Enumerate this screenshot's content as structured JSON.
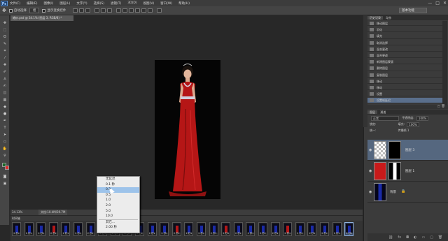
{
  "app": {
    "logo": "Ps"
  },
  "menubar": {
    "items": [
      "文件(F)",
      "编辑(E)",
      "图像(I)",
      "图层(L)",
      "文字(Y)",
      "选择(S)",
      "滤镜(T)",
      "3D(D)",
      "视图(V)",
      "窗口(W)",
      "帮助(H)"
    ],
    "window_controls": [
      "—",
      "□",
      "✕"
    ]
  },
  "options_bar": {
    "auto_select_label": "自动选择",
    "auto_select_value": "组",
    "show_transform_label": "显示变换控件",
    "workspace": "基本功能"
  },
  "document": {
    "tab_title": "婚纱.psd @ 34.1% (图层 3, RGB/8) *",
    "zoom": "34.13%",
    "doc_info": "文档:10.4M/39.7M"
  },
  "timeline": {
    "title": "时间轴",
    "frames": [
      {
        "label": "2 秒▾",
        "color": "blue"
      },
      {
        "label": "2 秒▾",
        "color": "blue"
      },
      {
        "label": "2 秒▾",
        "color": "blue"
      },
      {
        "label": "2 秒▾",
        "color": "red"
      },
      {
        "label": "2 秒▾",
        "color": "blue"
      },
      {
        "label": "2 秒▾",
        "color": "blue"
      },
      {
        "label": "2 秒▾",
        "color": "blue"
      },
      {
        "label": "2 秒▾",
        "color": "blue"
      },
      {
        "label": "2 秒▾",
        "color": "blue"
      },
      {
        "label": "2 秒▾",
        "color": "red"
      },
      {
        "label": "2 秒▾",
        "color": "blue"
      },
      {
        "label": "2 秒▾",
        "color": "blue"
      },
      {
        "label": "2 秒▾",
        "color": "blue"
      },
      {
        "label": "2 秒▾",
        "color": "red"
      },
      {
        "label": "2 秒▾",
        "color": "blue"
      },
      {
        "label": "2 秒▾",
        "color": "blue"
      },
      {
        "label": "2 秒▾",
        "color": "blue"
      },
      {
        "label": "2 秒▾",
        "color": "red"
      },
      {
        "label": "2 秒▾",
        "color": "blue"
      },
      {
        "label": "2 秒▾",
        "color": "blue"
      },
      {
        "label": "2 秒▾",
        "color": "blue"
      },
      {
        "label": "2 秒▾",
        "color": "blue"
      },
      {
        "label": "2 秒▾",
        "color": "red"
      },
      {
        "label": "2 秒▾",
        "color": "blue"
      },
      {
        "label": "2 秒▾",
        "color": "blue"
      },
      {
        "label": "2 秒▾",
        "color": "blue"
      },
      {
        "label": "2 秒▾",
        "color": "blue"
      },
      {
        "label": "2 秒▾",
        "color": "blue"
      }
    ]
  },
  "delay_menu": {
    "items": [
      "无延迟",
      "0.1 秒",
      "0.2",
      "0.5",
      "1.0",
      "2.0",
      "5.0",
      "10.0",
      "其它...",
      "2.00 秒"
    ],
    "highlighted": "0.2"
  },
  "history_panel": {
    "tabs": [
      "历史记录",
      "动作"
    ],
    "items": [
      "移动图层",
      "羽化",
      "填充",
      "取消选择",
      "混合更改",
      "混合更改",
      "新建图层蒙版",
      "删除图层",
      "复制图层",
      "移动",
      "移动",
      "设置",
      "设置帧延迟"
    ],
    "active_index": 12
  },
  "layers_panel": {
    "tabs": [
      "图层",
      "通道"
    ],
    "blend_mode": "正常",
    "opacity_label": "不透明度:",
    "opacity": "100%",
    "lock_label": "锁定:",
    "fill_label": "填充:",
    "fill": "100%",
    "unify_label": "统一:",
    "propagate_label": "传播帧 1",
    "layers": [
      {
        "name": "图层 3",
        "selected": true
      },
      {
        "name": "图层 1",
        "selected": false
      },
      {
        "name": "背景",
        "selected": false
      }
    ],
    "footer_icons": [
      "link-icon",
      "fx-icon",
      "mask-icon",
      "adjust-icon",
      "folder-icon",
      "new-layer-icon",
      "trash-icon"
    ]
  },
  "colors": {
    "accent": "#5a6f8c",
    "dress_red": "#c41818",
    "dress_blue": "#1a2aa8"
  }
}
